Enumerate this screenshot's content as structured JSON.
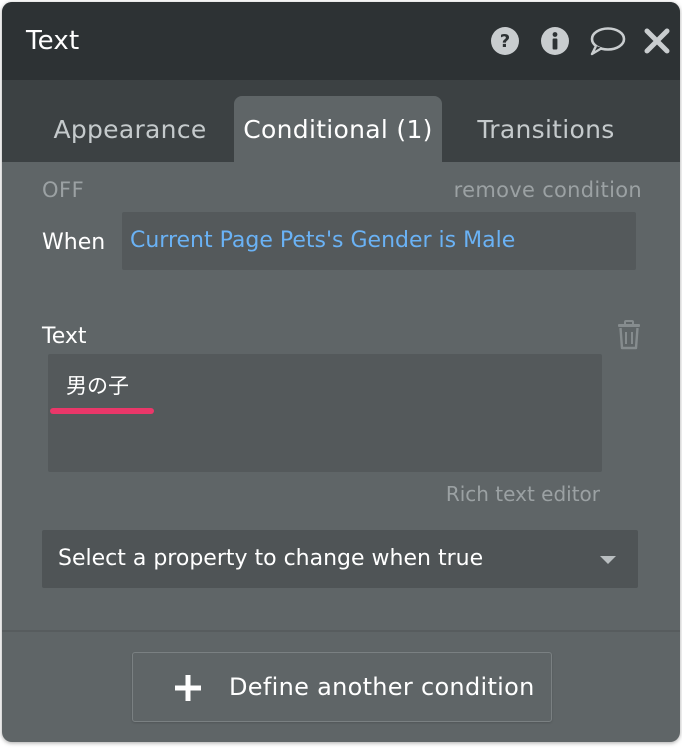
{
  "header": {
    "title": "Text",
    "icons": [
      "help-icon",
      "info-icon",
      "comment-icon",
      "close-icon"
    ]
  },
  "tabs": [
    {
      "label": "Appearance",
      "active": false
    },
    {
      "label": "Conditional (1)",
      "active": true
    },
    {
      "label": "Transitions",
      "active": false
    }
  ],
  "condition": {
    "status": "OFF",
    "remove_label": "remove condition",
    "when_label": "When",
    "expression": "Current Page Pets's Gender is Male"
  },
  "property": {
    "label": "Text",
    "value": "男の子",
    "rich_editor_label": "Rich text editor"
  },
  "select": {
    "placeholder": "Select a property to change when true"
  },
  "define_button": {
    "label": "Define another condition"
  },
  "colors": {
    "header_bg": "#2d3234",
    "tabbar_bg": "#3c4143",
    "panel_bg": "#5f6567",
    "expression_text": "#6ab2f5",
    "spellcheck_underline": "#ea3769"
  }
}
